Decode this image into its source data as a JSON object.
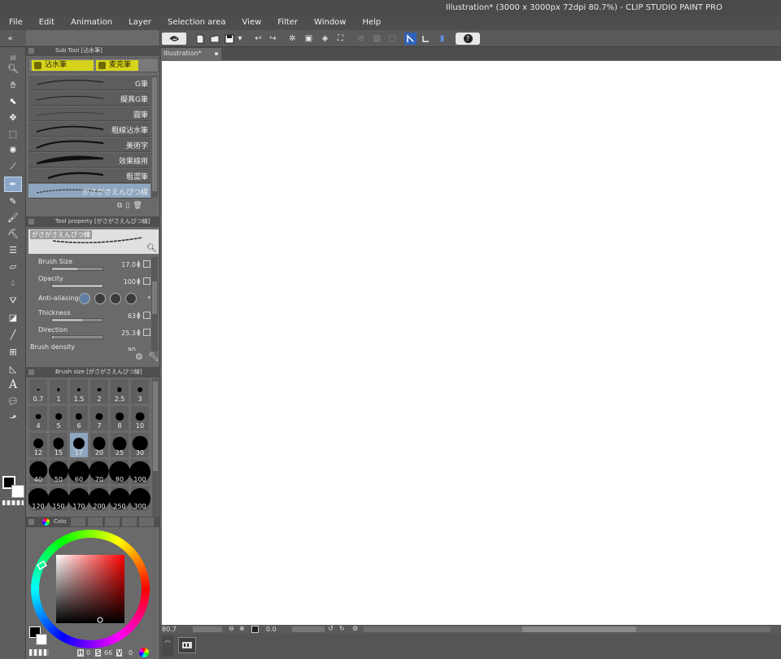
{
  "window": {
    "title": "Illustration* (3000 x 3000px 72dpi 80.7%)  - CLIP STUDIO PAINT PRO"
  },
  "menu": [
    "File",
    "Edit",
    "Animation",
    "Layer",
    "Selection area",
    "View",
    "Filter",
    "Window",
    "Help"
  ],
  "command_bar": {
    "help_icon": "?"
  },
  "tools": [
    "zoom-icon",
    "hand-icon",
    "object-icon",
    "move-icon",
    "selection-rect-icon",
    "magic-wand-icon",
    "eyedropper-icon",
    "pen-icon",
    "pencil-icon",
    "brush-icon",
    "airbrush-icon",
    "decoration-icon",
    "eraser-icon",
    "blend-icon",
    "fill-icon",
    "gradient-icon",
    "figure-icon",
    "frame-icon",
    "ruler-icon",
    "text-icon",
    "balloon-icon",
    "correct-line-icon"
  ],
  "text_tool_glyph": "A",
  "colors": {
    "main": "#000000",
    "sub": "#ffffff",
    "accent_yellow": "#d7d31c",
    "selection_blue": "#8ea6bf"
  },
  "sub_tool": {
    "header": "Sub Tool [沾水筆]",
    "groups": [
      "沾水筆",
      "麦克筆"
    ],
    "brushes": [
      {
        "name": "G筆",
        "selected": false
      },
      {
        "name": "擬真G筆",
        "selected": false
      },
      {
        "name": "圓筆",
        "selected": false
      },
      {
        "name": "粗線沾水筆",
        "selected": false
      },
      {
        "name": "美術字",
        "selected": false
      },
      {
        "name": "效果線用",
        "selected": false
      },
      {
        "name": "粗澀筆",
        "selected": false
      },
      {
        "name": "がさがさえんぴつ線",
        "selected": true
      }
    ]
  },
  "tool_property": {
    "header": "Tool property [がさがさえんぴつ線]",
    "preview_name": "がさがさえんぴつ線",
    "props": [
      {
        "label": "Brush Size",
        "value": "17.0",
        "fill": 0.5
      },
      {
        "label": "Opacity",
        "value": "100",
        "fill": 1.0
      },
      {
        "label": "Anti-aliasing",
        "value": "",
        "fill": null
      },
      {
        "label": "Thickness",
        "value": "63",
        "fill": 0.6
      },
      {
        "label": "Direction",
        "value": "25.3",
        "fill": 0.03
      },
      {
        "label": "Brush density",
        "value": "90",
        "fill": null
      }
    ]
  },
  "brush_size": {
    "header": "Brush size [がさがさえんぴつ線]",
    "sizes": [
      "0.7",
      "1",
      "1.5",
      "2",
      "2.5",
      "3",
      "4",
      "5",
      "6",
      "7",
      "8",
      "10",
      "12",
      "15",
      "17",
      "20",
      "25",
      "30",
      "40",
      "50",
      "60",
      "70",
      "80",
      "100",
      "120",
      "150",
      "170",
      "200",
      "250",
      "300"
    ],
    "selected": "17"
  },
  "color_panel": {
    "header": "Colo",
    "values": {
      "h": "0",
      "s": "66",
      "v": "0"
    }
  },
  "document": {
    "tab": "Illustration*"
  },
  "status": {
    "zoom": "80.7",
    "rotation": "0.0"
  }
}
